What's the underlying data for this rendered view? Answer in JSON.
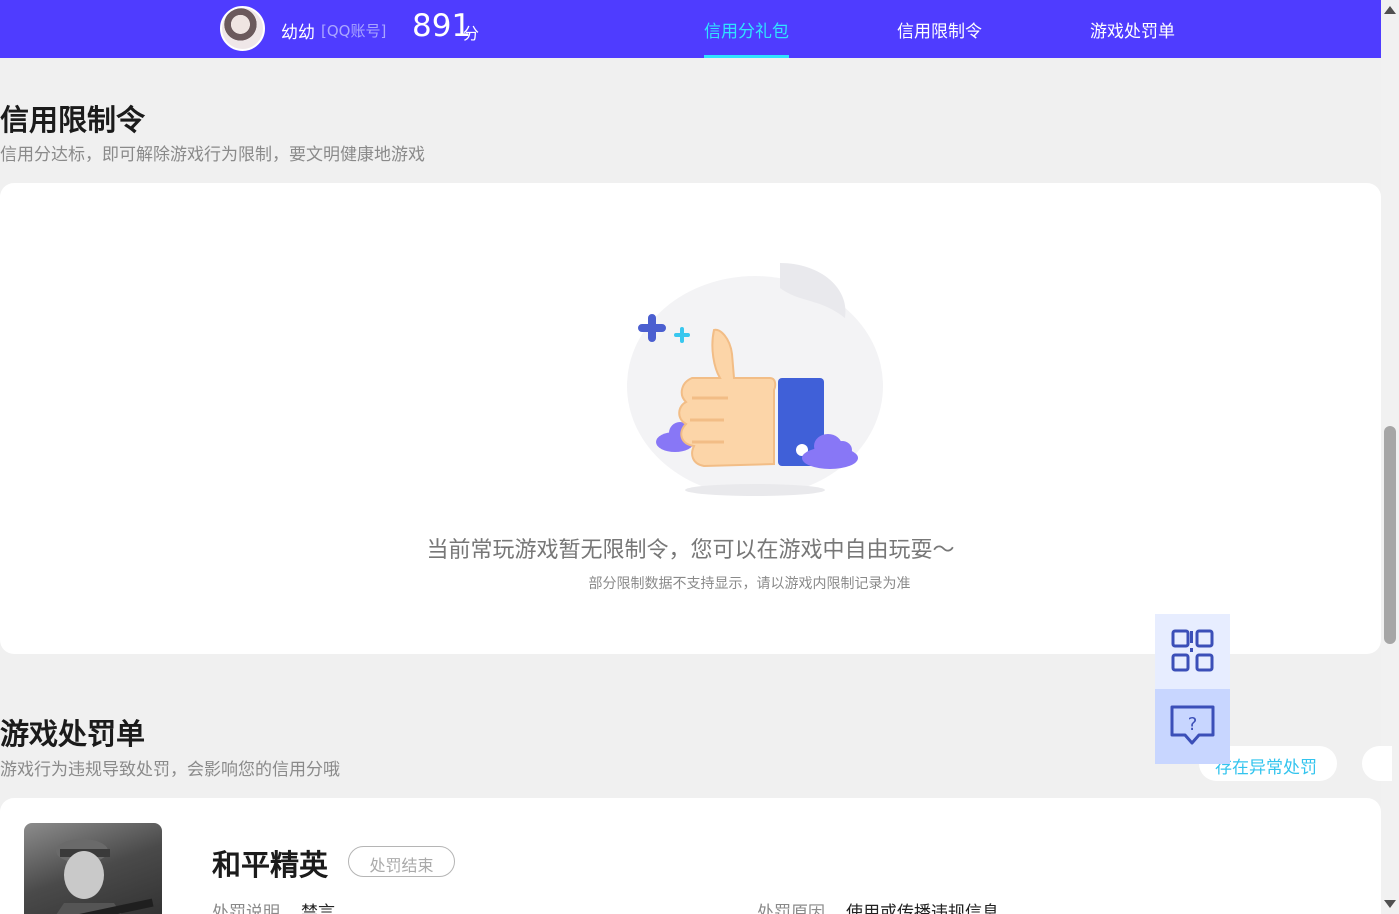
{
  "header": {
    "username": "幼幼",
    "account_type": "[QQ账号]",
    "score": "891",
    "score_unit": "分",
    "tabs": [
      {
        "label": "信用分礼包",
        "active": true
      },
      {
        "label": "信用限制令",
        "active": false
      },
      {
        "label": "游戏处罚单",
        "active": false
      }
    ],
    "accent_color": "#4f3cff",
    "active_tab_color": "#30e3ff"
  },
  "restriction": {
    "title": "信用限制令",
    "subtitle": "信用分达标，即可解除游戏行为限制，要文明健康地游戏",
    "empty_message": "当前常玩游戏暂无限制令，您可以在游戏中自由玩耍～",
    "empty_note": "部分限制数据不支持显示，请以游戏内限制记录为准",
    "illustration_icon": "thumbs-up-icon"
  },
  "penalty": {
    "title": "游戏处罚单",
    "subtitle": "游戏行为违规导致处罚，会影响您的信用分哦",
    "filter_pill": "存在异常处罚",
    "games": [
      {
        "name": "和平精英",
        "status_badge": "处罚结束",
        "desc_label": "处罚说明",
        "desc_value": "禁言",
        "reason_label": "处罚原因",
        "reason_value": "使用或传播违规信息"
      }
    ]
  },
  "floating": {
    "qr_icon": "qr-code-icon",
    "help_icon": "help-chat-icon"
  }
}
